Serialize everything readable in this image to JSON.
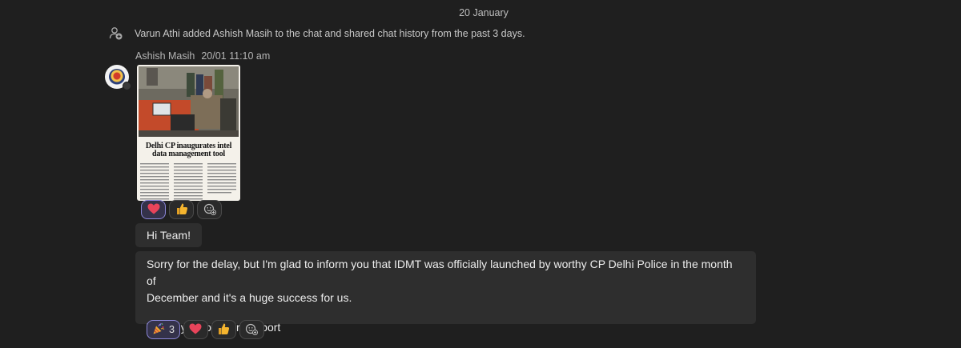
{
  "chat": {
    "date_divider": "20 January",
    "system_message": "Varun Athi added Ashish Masih to the chat and shared chat history from the past 3 days.",
    "message": {
      "sender": "Ashish Masih",
      "timestamp": "20/01 11:10 am",
      "image": {
        "headline_line1": "Delhi CP inaugurates intel",
        "headline_line2": "data management tool"
      },
      "image_reactions": [
        {
          "icon": "heart-icon",
          "glyph": "❤️",
          "active": true
        },
        {
          "icon": "thumbs-up-icon",
          "glyph": "👍",
          "active": false
        },
        {
          "icon": "add-reaction-icon",
          "glyph": "",
          "active": false
        }
      ],
      "text_1": "Hi Team!",
      "text_2_line1": "Sorry for the delay, but I'm glad to inform you that IDMT was officially launched by worthy CP Delhi Police in the month of",
      "text_2_line2": "December and it's a huge success for us.",
      "text_2_line3": "Thank you for your support",
      "text_reactions": [
        {
          "icon": "party-popper-icon",
          "glyph": "🎉",
          "count": "3",
          "active": true
        },
        {
          "icon": "heart-icon",
          "glyph": "❤️",
          "active": false
        },
        {
          "icon": "thumbs-up-icon",
          "glyph": "👍",
          "active": false
        },
        {
          "icon": "add-reaction-icon",
          "glyph": "",
          "active": false
        }
      ]
    }
  },
  "colors": {
    "background": "#1f1f1f",
    "bubble": "#2e2e2e",
    "active_reaction_border": "#8b86d9",
    "heart": "#e8445a",
    "thumbs": "#f5b52e"
  }
}
